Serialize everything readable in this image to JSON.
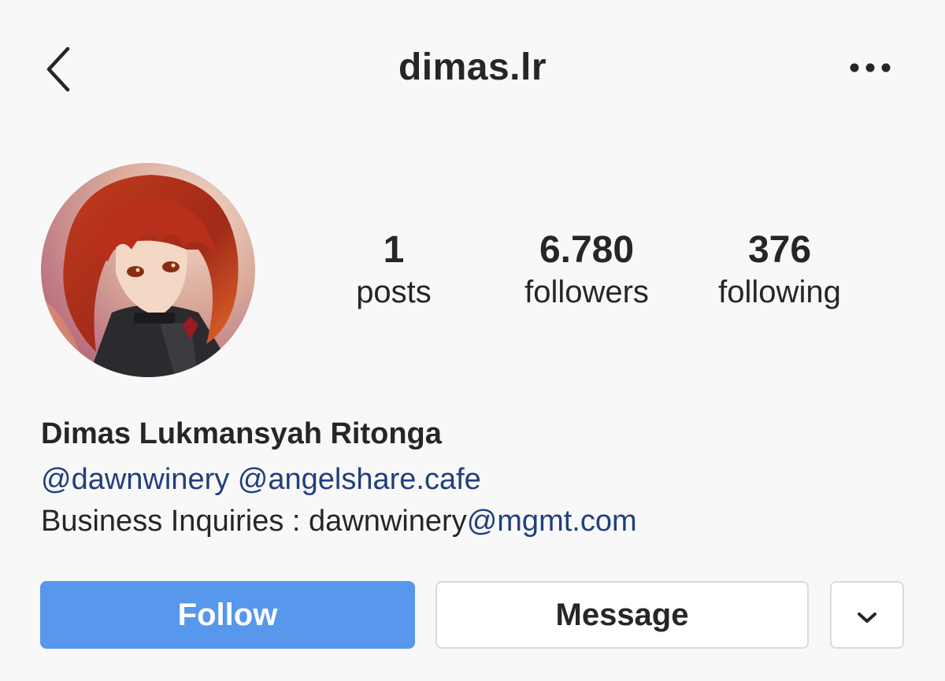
{
  "header": {
    "username": "dimas.lr",
    "back_icon": "chevron-left-icon",
    "more_icon": "more-horizontal-icon"
  },
  "profile": {
    "avatar_icon": "profile-avatar",
    "stats": {
      "posts": {
        "value": "1",
        "label": "posts"
      },
      "followers": {
        "value": "6.780",
        "label": "followers"
      },
      "following": {
        "value": "376",
        "label": "following"
      }
    },
    "full_name": "Dimas Lukmansyah Ritonga",
    "bio": {
      "mention_1": "@dawnwinery",
      "mention_2": "@angelshare.cafe",
      "inquiry_prefix": "Business Inquiries : dawnwinery",
      "inquiry_link": "@mgmt.com"
    }
  },
  "actions": {
    "follow_label": "Follow",
    "message_label": "Message",
    "dropdown_icon": "chevron-down-icon"
  },
  "colors": {
    "accent": "#5797ec",
    "mention": "#223f7d",
    "background": "#f8f8f8",
    "text": "#262626"
  }
}
